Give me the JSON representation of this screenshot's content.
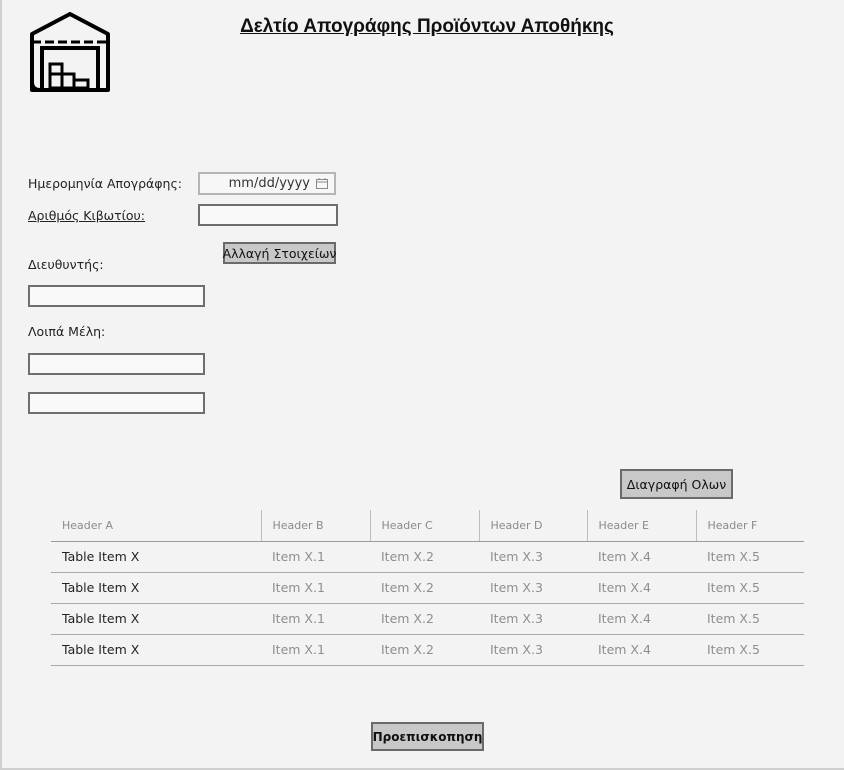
{
  "header": {
    "title": "Δελτίο Απογράφης Προϊόντων Αποθήκης",
    "logo_icon": "warehouse-icon"
  },
  "form": {
    "date_label": "Ημερομηνία Απογράφης:",
    "date_placeholder": "mm/dd/yyyy",
    "box_number_label": "Αριθμός Κιβωτίου:",
    "box_number_value": "",
    "change_details_button": "Αλλαγή Στοιχείων",
    "director_label": "Διευθυντής:",
    "director_value": "",
    "other_members_label": "Λοιπά Μέλη:",
    "member_1_value": "",
    "member_2_value": ""
  },
  "table": {
    "delete_all_button": "Διαγραφή Ολων",
    "headers": [
      "Header A",
      "Header B",
      "Header C",
      "Header D",
      "Header E",
      "Header F"
    ],
    "rows": [
      [
        "Table Item X",
        "Item X.1",
        "Item X.2",
        "Item X.3",
        "Item X.4",
        "Item X.5"
      ],
      [
        "Table Item X",
        "Item X.1",
        "Item X.2",
        "Item X.3",
        "Item X.4",
        "Item X.5"
      ],
      [
        "Table Item X",
        "Item X.1",
        "Item X.2",
        "Item X.3",
        "Item X.4",
        "Item X.5"
      ],
      [
        "Table Item X",
        "Item X.1",
        "Item X.2",
        "Item X.3",
        "Item X.4",
        "Item X.5"
      ]
    ]
  },
  "footer": {
    "preview_button": "Προεπισκοπηση"
  },
  "colors": {
    "background": "#f3f3f3",
    "button": "#c8c8c8",
    "border": "#6e6e6e"
  }
}
